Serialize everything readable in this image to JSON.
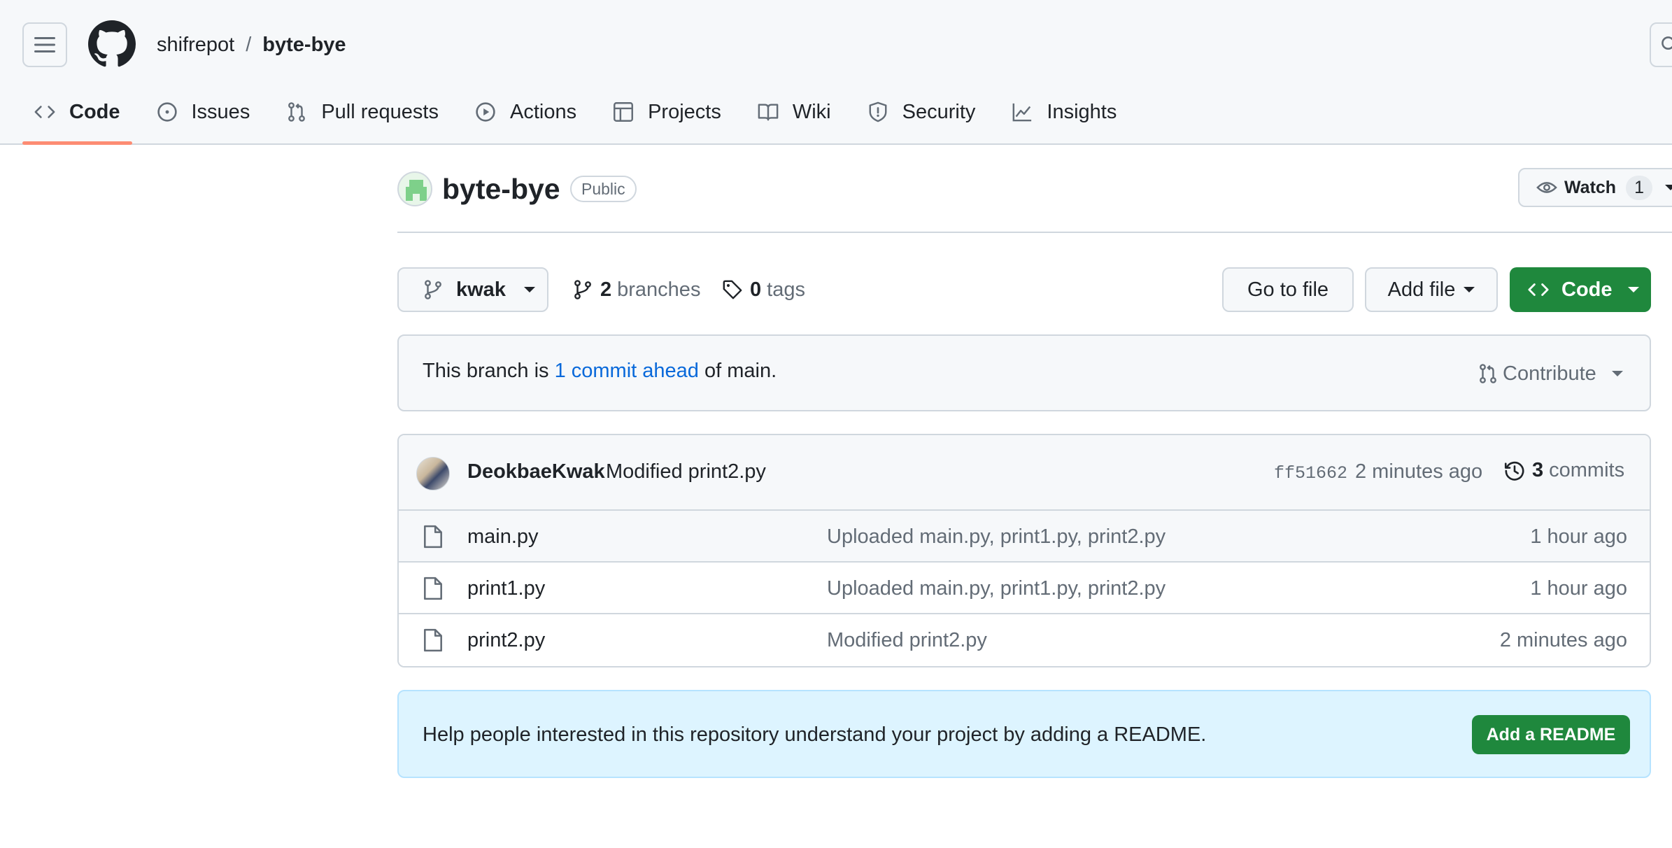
{
  "header": {
    "owner": "shifrepot",
    "separator": "/",
    "repo": "byte-bye"
  },
  "tabs": [
    {
      "label": "Code",
      "icon": "code-icon",
      "active": true
    },
    {
      "label": "Issues",
      "icon": "issue-icon"
    },
    {
      "label": "Pull requests",
      "icon": "pull-request-icon"
    },
    {
      "label": "Actions",
      "icon": "play-icon"
    },
    {
      "label": "Projects",
      "icon": "table-icon"
    },
    {
      "label": "Wiki",
      "icon": "book-icon"
    },
    {
      "label": "Security",
      "icon": "shield-icon"
    },
    {
      "label": "Insights",
      "icon": "graph-icon"
    }
  ],
  "repo_head": {
    "title": "byte-bye",
    "visibility": "Public",
    "watch_label": "Watch",
    "watch_count": "1"
  },
  "branch_bar": {
    "branch": "kwak",
    "branches_count": "2",
    "branches_label": "branches",
    "tags_count": "0",
    "tags_label": "tags",
    "go_to_file": "Go to file",
    "add_file": "Add file",
    "code": "Code"
  },
  "ahead": {
    "prefix": "This branch is",
    "link": "1 commit ahead",
    "suffix": "of main.",
    "contribute": "Contribute"
  },
  "latest_commit": {
    "author": "DeokbaeKwak",
    "message": "Modified print2.py",
    "sha": "ff51662",
    "time": "2 minutes ago",
    "commits_count": "3",
    "commits_label": "commits"
  },
  "files": [
    {
      "name": "main.py",
      "message": "Uploaded main.py, print1.py, print2.py",
      "age": "1 hour ago"
    },
    {
      "name": "print1.py",
      "message": "Uploaded main.py, print1.py, print2.py",
      "age": "1 hour ago"
    },
    {
      "name": "print2.py",
      "message": "Modified print2.py",
      "age": "2 minutes ago"
    }
  ],
  "readme": {
    "text": "Help people interested in this repository understand your project by adding a README.",
    "button": "Add a README"
  },
  "colors": {
    "accent_underline": "#fd8c73",
    "primary_green": "#1f883d",
    "link_blue": "#0969da",
    "banner_bg": "#ddf4ff"
  }
}
